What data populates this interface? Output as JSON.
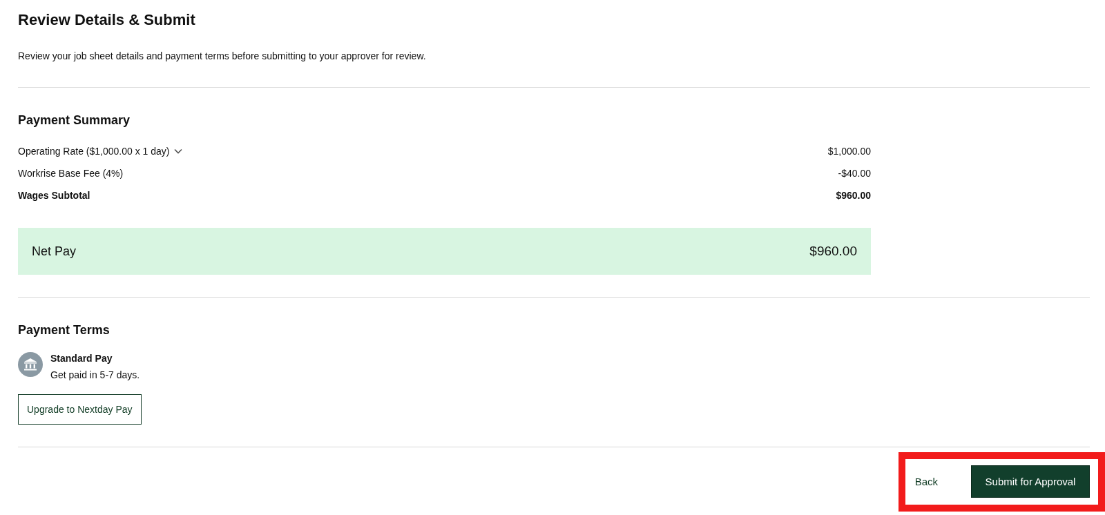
{
  "title": "Review Details & Submit",
  "description": "Review your job sheet details and payment terms before submitting to your approver for review.",
  "payment_summary": {
    "heading": "Payment Summary",
    "rows": [
      {
        "kind": "line",
        "label": "Operating Rate ($1,000.00 x 1 day)",
        "expandable": true,
        "expanded": false,
        "value": "$1,000.00"
      },
      {
        "kind": "line",
        "label": "Workrise Base Fee (4%)",
        "value": "-$40.00"
      },
      {
        "kind": "subtotal",
        "label": "Wages Subtotal",
        "value": "$960.00"
      }
    ],
    "net_pay": {
      "label": "Net Pay",
      "value": "$960.00"
    }
  },
  "payment_terms": {
    "heading": "Payment Terms",
    "option": {
      "name": "Standard Pay",
      "detail": "Get paid in 5-7 days."
    },
    "upgrade_button": "Upgrade to Nextday Pay"
  },
  "actions": {
    "back": "Back",
    "submit": "Submit for Approval"
  }
}
